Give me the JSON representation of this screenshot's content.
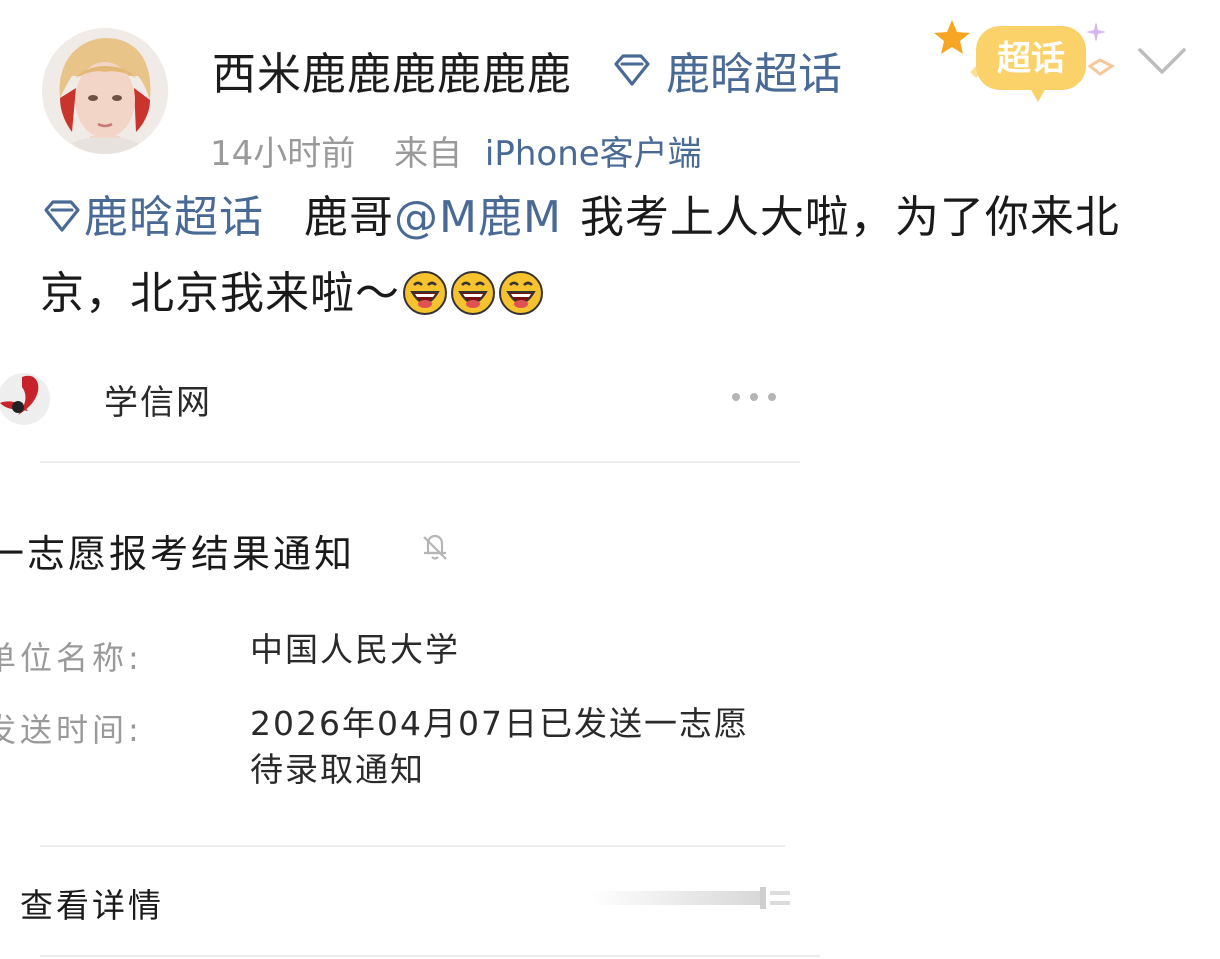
{
  "post": {
    "username": "西米鹿鹿鹿鹿鹿鹿",
    "topic": "鹿晗超话",
    "time": "14小时前",
    "source_prefix": "来自",
    "source_device": "iPhone客户端",
    "badge_text": "超话",
    "content_topic": "鹿晗超话",
    "content_text_1": "鹿哥",
    "content_mention": "@M鹿M",
    "content_text_2": "我考上人大啦，为了你来北京，北京我来啦～",
    "emojis": [
      "laughing-emoji",
      "laughing-emoji",
      "laughing-emoji"
    ]
  },
  "embed": {
    "sender_name": "学信网",
    "notice_title": "一志愿报考结果通知",
    "fields": [
      {
        "label": "单位名称:",
        "value": "中国人民大学"
      },
      {
        "label": "发送时间:",
        "value": "2026年04月07日已发送一志愿待录取通知"
      }
    ],
    "detail_label": "查看详情"
  },
  "colors": {
    "link_blue": "#4a6a96",
    "muted_gray": "#9a9a9a",
    "badge_orange": "#f6a623"
  },
  "icons": [
    "diamond-icon",
    "chevron-down-icon",
    "more-icon",
    "bell-off-icon",
    "xuexin-logo"
  ]
}
